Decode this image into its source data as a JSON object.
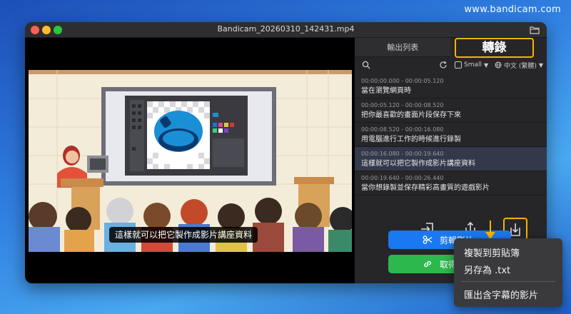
{
  "watermark": "www.bandicam.com",
  "window": {
    "title": "Bandicam_20260310_142431.mp4"
  },
  "video": {
    "subtitle": "這樣就可以把它製作成影片講座資料"
  },
  "panel": {
    "tabs": [
      {
        "label": "輸出列表"
      },
      {
        "label": "轉錄"
      }
    ],
    "toolbar": {
      "size_label": "Small",
      "language_label": "中文 (繁體)"
    },
    "subtitles": [
      {
        "time": "00:00:00.000 - 00:00:05.120",
        "text": "當在瀏覽網頁時"
      },
      {
        "time": "00:00:05.120 - 00:00:08.520",
        "text": "把你最喜歡的畫面片段保存下來"
      },
      {
        "time": "00:00:08.520 - 00:00:16.080",
        "text": "用電腦進行工作的時候進行錄製"
      },
      {
        "time": "00:00:16.080 - 00:00:19.640",
        "text": "這樣就可以把它製作成影片講座資料"
      },
      {
        "time": "00:00:19.640 - 00:00:26.440",
        "text": "當你想錄製並保存精彩高畫質的遊戲影片"
      }
    ],
    "buttons": {
      "cut_label": "剪輯影片",
      "get_label": "取得分享"
    }
  },
  "context_menu": {
    "items": [
      {
        "label": "複製到剪貼簿"
      },
      {
        "label": "另存為 .txt"
      },
      {
        "label": "匯出含字幕的影片"
      }
    ]
  },
  "colors": {
    "accent_highlight": "#f6b300",
    "cut_button": "#1a79f0",
    "share_button": "#2cb84d"
  }
}
